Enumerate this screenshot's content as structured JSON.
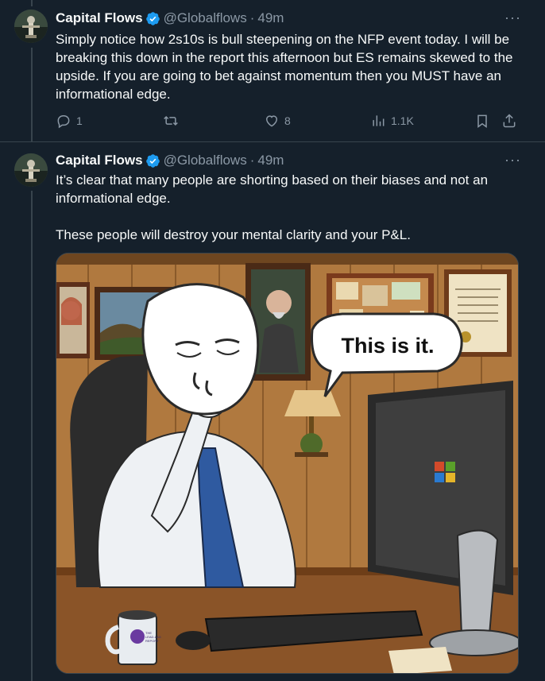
{
  "tweets": [
    {
      "author_name": "Capital Flows",
      "handle": "@Globalflows",
      "separator": "·",
      "time": "49m",
      "more": "···",
      "paragraphs": [
        "Simply notice how 2s10s is bull steepening on the NFP event today. I will be breaking this down in the report this afternoon but ES remains skewed to the upside. If you are going to bet against momentum then you MUST have an informational edge."
      ],
      "actions": {
        "replies": "1",
        "reposts": "",
        "likes": "8",
        "views": "1.1K"
      }
    },
    {
      "author_name": "Capital Flows",
      "handle": "@Globalflows",
      "separator": "·",
      "time": "49m",
      "more": "···",
      "paragraphs": [
        "It’s clear that many people are shorting based on their biases and not an informational edge.",
        "These people will destroy your mental clarity and your P&L."
      ],
      "media": {
        "speech_bubble": "This is it.",
        "mug_text_line1": "THE",
        "mug_text_line2": "LEAD-LAG",
        "mug_text_line3": "REPORT"
      }
    }
  ],
  "icons": {
    "verified": "verified-badge-icon",
    "reply": "reply-icon",
    "repost": "repost-icon",
    "like": "heart-icon",
    "views": "views-icon",
    "bookmark": "bookmark-icon",
    "share": "share-icon"
  },
  "colors": {
    "background": "#15202b",
    "text": "#f7f9f9",
    "muted": "#8b98a5",
    "verified": "#1d9bf0",
    "border": "#38444d"
  }
}
